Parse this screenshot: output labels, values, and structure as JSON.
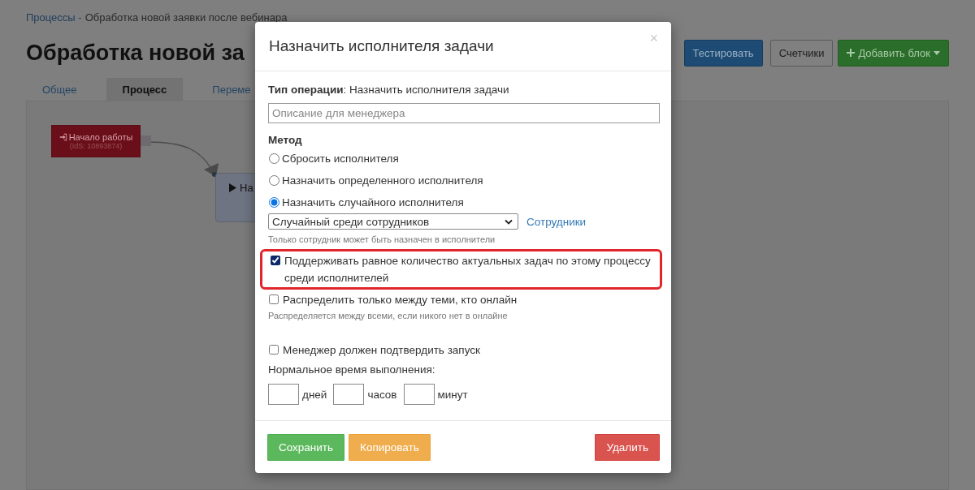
{
  "breadcrumb": {
    "link": "Процессы -",
    "current": "Обработка новой заявки после вебинара"
  },
  "page_title": "Обработка новой за",
  "toolbar_buttons": [
    {
      "label": "Тестировать",
      "kind": "primary"
    },
    {
      "label": "Счетчики",
      "kind": "default"
    },
    {
      "label": "Добавить блок",
      "kind": "success"
    }
  ],
  "tabs": [
    {
      "label": "Общее",
      "selected": false
    },
    {
      "label": "Процесс",
      "selected": true
    },
    {
      "label": "Переме",
      "selected": false
    }
  ],
  "canvas_nodes": [
    {
      "kind": "start",
      "title": "Начало работы",
      "subtitle": "(IdS: 10893874)"
    },
    {
      "kind": "task",
      "title": "На"
    }
  ],
  "dialog": {
    "title": "Назначить исполнителя задачи",
    "close": "×",
    "operation_type": "**Тип операции**: Назначить исполнителя задачи",
    "description_placeholder": "Описание для менеджера",
    "method_label": "Метод",
    "methods": [
      {
        "label": "Сбросить исполнителя",
        "selected": false
      },
      {
        "label": "Назначить определенного исполнителя",
        "selected": false
      },
      {
        "label": "Назначить случайного исполнителя",
        "selected": true
      }
    ],
    "assignee_select": "Случайный среди сотрудников",
    "employees_link": "Сотрудники",
    "select_hint": "Только сотрудник может быть назначен в исполнители",
    "options": [
      {
        "label": "Поддерживать равное количество актуальных задач по этому процессу среди исполнителей",
        "checked": true,
        "highlighted": true
      },
      {
        "label": "Распределить только между теми, кто онлайн",
        "checked": false,
        "highlighted": false,
        "hint": "Распределяется между всеми, если никого нет в онлайне"
      },
      {
        "label": "Менеджер должен подтвердить запуск",
        "checked": false,
        "highlighted": false
      }
    ],
    "duration_label": "Нормальное время выполнения:",
    "duration_units": [
      "дней",
      "часов",
      "минут"
    ],
    "buttons": [
      {
        "label": "Сохранить",
        "kind": "success"
      },
      {
        "label": "Копировать",
        "kind": "warning"
      },
      {
        "label": "Удалить",
        "kind": "danger"
      }
    ]
  }
}
